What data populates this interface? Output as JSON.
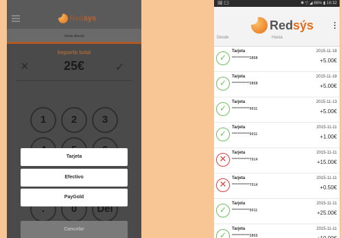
{
  "left_phone": {
    "app_name_prefix": "Red",
    "app_name_suffix": "sys",
    "subtitle": "Venta directa",
    "amount_label": "Importe total",
    "amount": "25€",
    "cancel_glyph": "×",
    "confirm_glyph": "✓",
    "keys": [
      "1",
      "2",
      "3",
      "4",
      "5",
      "6",
      ".",
      "0",
      "Del"
    ],
    "payment_options": [
      "Tarjeta",
      "Efectivo",
      "PayGold"
    ],
    "cancel_label": "Cancelar",
    "icons": {
      "menu": "hamburger-menu-icon",
      "logo": "redsys-logo-icon"
    }
  },
  "right_phone": {
    "status_left": "🖼 ✉",
    "status_right": "✱ ▽ ◢ 86% ▮ 16:32",
    "app_name_prefix": "Red",
    "app_name_suffix": "sýs",
    "filter_from": "Desde",
    "filter_to": "Hasta",
    "transactions": [
      {
        "type": "Tarjeta",
        "card": "************2858",
        "date": "2015-11-18",
        "amount": "+5.00€",
        "status": "ok"
      },
      {
        "type": "Tarjeta",
        "card": "************2858",
        "date": "2015-11-18",
        "amount": "+5.00€",
        "status": "ok"
      },
      {
        "type": "Tarjeta",
        "card": "************0011",
        "date": "2015-11-13",
        "amount": "+5.00€",
        "status": "ok"
      },
      {
        "type": "Tarjeta",
        "card": "************0011",
        "date": "2015-11-11",
        "amount": "+1.00€",
        "status": "ok"
      },
      {
        "type": "Tarjeta",
        "card": "************7014",
        "date": "2015-11-11",
        "amount": "+15.00€",
        "status": "fail"
      },
      {
        "type": "Tarjeta",
        "card": "************7014",
        "date": "2015-11-11",
        "amount": "+0.50€",
        "status": "fail"
      },
      {
        "type": "Tarjeta",
        "card": "************0011",
        "date": "2015-11-11",
        "amount": "+25.00€",
        "status": "ok"
      },
      {
        "type": "Tarjeta",
        "card": "************2855",
        "date": "2015-11-11",
        "amount": "+10.00€",
        "status": "ok"
      }
    ],
    "status_glyphs": {
      "ok": "✓",
      "fail": "✕"
    },
    "colors": {
      "accent": "#e36d18",
      "ok": "#6bbf5a",
      "fail": "#d93b3b"
    }
  }
}
